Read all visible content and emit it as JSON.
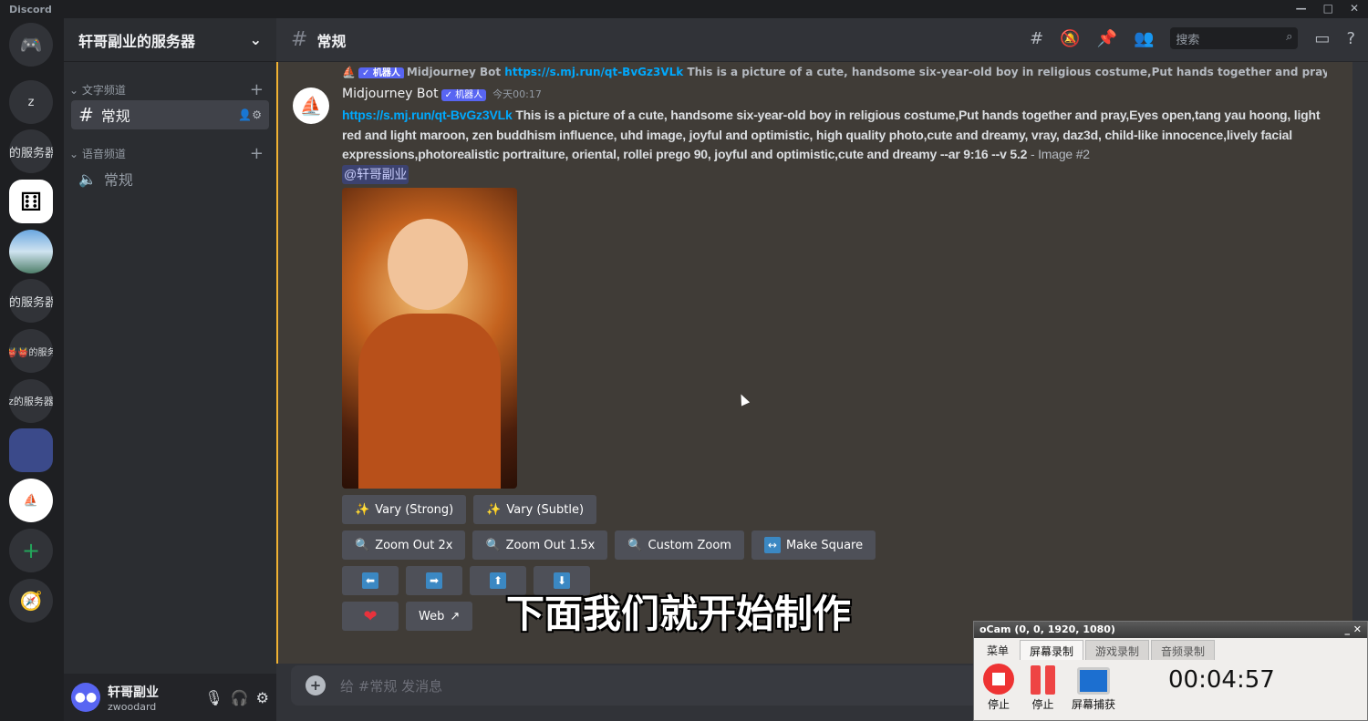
{
  "app": {
    "title": "Discord",
    "window_controls": [
      "—",
      "□",
      "✕"
    ]
  },
  "rail": {
    "servers": [
      {
        "label": "",
        "icon": "discord-logo-icon"
      },
      {
        "label": "z"
      },
      {
        "label": "的服务器"
      },
      {
        "label": "",
        "icon": "dice-icon"
      },
      {
        "label": "",
        "icon": "landscape-icon"
      },
      {
        "label": "的服务器"
      },
      {
        "label": "👹👹的服务"
      },
      {
        "label": "z的服务器"
      },
      {
        "label": "",
        "icon": "folder-icon"
      },
      {
        "label": "",
        "icon": "midjourney-icon"
      }
    ],
    "add": "+",
    "explore": "compass-icon"
  },
  "sidebar": {
    "server_name": "轩哥副业的服务器",
    "categories": [
      {
        "name": "文字频道",
        "channels": [
          {
            "name": "常规",
            "type": "text"
          }
        ]
      },
      {
        "name": "语音频道",
        "channels": [
          {
            "name": "常规",
            "type": "voice"
          }
        ]
      }
    ]
  },
  "user": {
    "name": "轩哥副业",
    "tag": "zwoodard"
  },
  "header": {
    "channel": "常规",
    "search_placeholder": "搜索"
  },
  "message": {
    "reply": {
      "author": "Midjourney Bot",
      "badge": "✓ 机器人",
      "link": "https://s.mj.run/qt-BvGz3VLk",
      "text": "This is a picture of a cute, handsome six-year-old boy in religious costume,Put hands together and pray,Eyes open,"
    },
    "author": "Midjourney Bot",
    "badge": "✓ 机器人",
    "time": "今天00:17",
    "link": "https://s.mj.run/qt-BvGz3VLk",
    "text": " This is a picture of a cute, handsome six-year-old boy in religious costume,Put hands together and pray,Eyes open,tang yau hoong, light red and light maroon, zen buddhism influence, uhd image, joyful and optimistic, high quality photo,cute and dreamy, vray, daz3d, child-like innocence,lively facial expressions,photorealistic portraiture, oriental, rollei prego 90, joyful and optimistic,cute and dreamy --ar 9:16 --v 5.2",
    "suffix": " - Image #2",
    "mention": "@轩哥副业",
    "buttons_row1": [
      "Vary (Strong)",
      "Vary (Subtle)"
    ],
    "buttons_row2": [
      "Zoom Out 2x",
      "Zoom Out 1.5x",
      "Custom Zoom",
      "Make Square"
    ],
    "buttons_row3": [
      "⬅",
      "➡",
      "⬆",
      "⬇"
    ],
    "buttons_row4": {
      "heart": "❤",
      "web": "Web"
    }
  },
  "composer": {
    "placeholder": "给 #常规 发消息"
  },
  "subtitle": "下面我们就开始制作",
  "ocam": {
    "title": "oCam (0, 0, 1920, 1080)",
    "tabs": [
      "菜单",
      "屏幕录制",
      "游戏录制",
      "音频录制"
    ],
    "active_tab": "屏幕录制",
    "tools": [
      "停止",
      "停止",
      "屏幕捕获"
    ],
    "timer": "00:04:57"
  }
}
